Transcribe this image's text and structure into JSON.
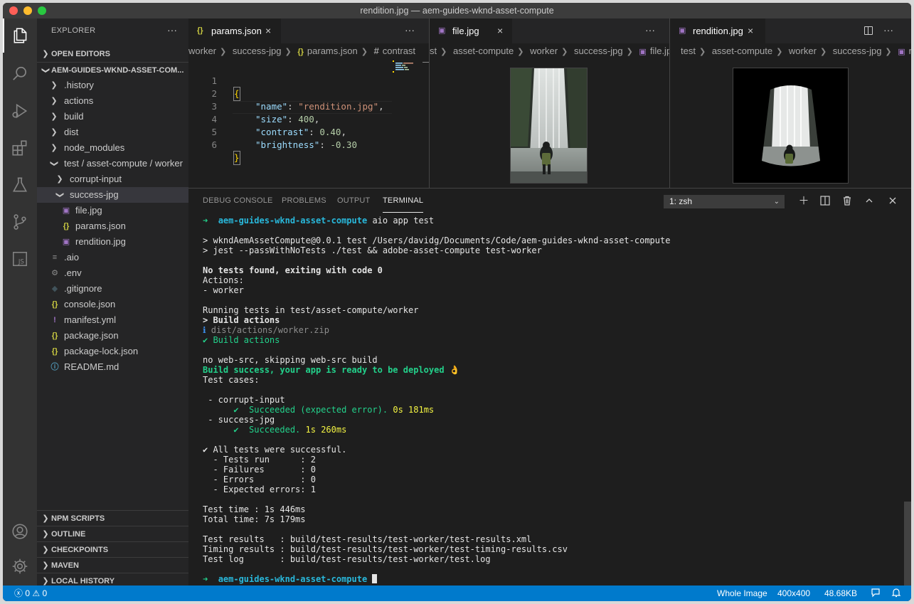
{
  "window": {
    "title": "rendition.jpg — aem-guides-wknd-asset-compute"
  },
  "sidebar": {
    "title": "EXPLORER",
    "more": "···",
    "open_editors": "OPEN EDITORS",
    "project": "AEM-GUIDES-WKND-ASSET-COM...",
    "tree": {
      "history": ".history",
      "actions": "actions",
      "build": "build",
      "dist": "dist",
      "node_modules": "node_modules",
      "test_path": "test / asset-compute / worker",
      "corrupt_input": "corrupt-input",
      "success_jpg": "success-jpg",
      "file_jpg": "file.jpg",
      "params_json": "params.json",
      "rendition_jpg": "rendition.jpg",
      "aio": ".aio",
      "env": ".env",
      "gitignore": ".gitignore",
      "console_json": "console.json",
      "manifest_yml": "manifest.yml",
      "package_json": "package.json",
      "package_lock": "package-lock.json",
      "readme": "README.md"
    },
    "sections": {
      "npm_scripts": "NPM SCRIPTS",
      "outline": "OUTLINE",
      "checkpoints": "CHECKPOINTS",
      "maven": "MAVEN",
      "local_history": "LOCAL HISTORY"
    }
  },
  "editor1": {
    "tab": "params.json",
    "breadcrumb": [
      "worker",
      "success-jpg",
      "params.json",
      "contrast"
    ],
    "lines": [
      "1",
      "2",
      "3",
      "4",
      "5",
      "6"
    ],
    "code": {
      "open": "{",
      "name_key": "\"name\"",
      "name_val": "\"rendition.jpg\"",
      "size_key": "\"size\"",
      "size_val": "400",
      "contrast_key": "\"contrast\"",
      "contrast_val": "0.40",
      "brightness_key": "\"brightness\"",
      "brightness_val": "-0.30",
      "close": "}"
    }
  },
  "editor2": {
    "tab": "file.jpg",
    "breadcrumb": [
      "st",
      "asset-compute",
      "worker",
      "success-jpg",
      "file.jpg"
    ]
  },
  "editor3": {
    "tab": "rendition.jpg",
    "breadcrumb": [
      "test",
      "asset-compute",
      "worker",
      "success-jpg",
      "ren"
    ]
  },
  "panel": {
    "tabs": [
      "DEBUG CONSOLE",
      "PROBLEMS",
      "OUTPUT",
      "TERMINAL"
    ],
    "terminal_select": "1: zsh",
    "terminal": {
      "prompt_dir": "aem-guides-wknd-asset-compute",
      "cmd": "aio app test",
      "l1": "> wkndAemAssetCompute@0.0.1 test /Users/davidg/Documents/Code/aem-guides-wknd-asset-compute",
      "l2": "> jest --passWithNoTests ./test && adobe-asset-compute test-worker",
      "l3": "No tests found, exiting with code 0",
      "l4": "Actions:",
      "l5": "- worker",
      "l6": "Running tests in test/asset-compute/worker",
      "l7": "> Build actions",
      "l8": "dist/actions/worker.zip",
      "l9": "✔ Build actions",
      "l10": "no web-src, skipping web-src build",
      "l11": "Build success, your app is ready to be deployed 👌",
      "l12": "Test cases:",
      "l13": " - corrupt-input",
      "l14a": "✔  Succeeded (expected error).",
      "l14b": "0s 181ms",
      "l15": " - success-jpg",
      "l16a": "✔  Succeeded.",
      "l16b": "1s 260ms",
      "l17": "✔ All tests were successful.",
      "l18": "  - Tests run      : 2",
      "l19": "  - Failures       : 0",
      "l20": "  - Errors         : 0",
      "l21": "  - Expected errors: 1",
      "l22": "Test time : 1s 446ms",
      "l23": "Total time: 7s 179ms",
      "l24": "Test results   : build/test-results/test-worker/test-results.xml",
      "l25": "Timing results : build/test-results/test-worker/test-timing-results.csv",
      "l26": "Test log       : build/test-results/test-worker/test.log"
    }
  },
  "status": {
    "errors": "0",
    "warnings": "0",
    "whole_image": "Whole Image",
    "dimensions": "400x400",
    "size": "48.68KB"
  },
  "colors": {
    "accent": "#007acc",
    "success": "#23d18b",
    "cyan": "#29b8db",
    "yellow": "#f5f543"
  }
}
